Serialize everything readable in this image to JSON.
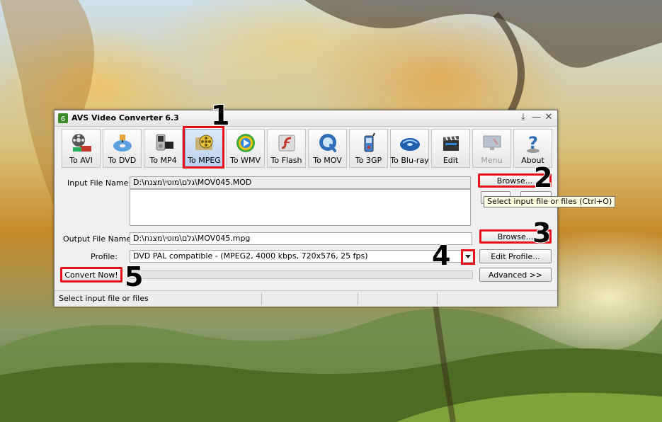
{
  "window": {
    "title": "AVS Video Converter 6.3"
  },
  "titlebar_controls": {
    "pin": "⤓",
    "minimize": "—",
    "close": "✕"
  },
  "toolbar": [
    {
      "label": "To AVI",
      "icon": "film-avi-icon"
    },
    {
      "label": "To DVD",
      "icon": "dvd-disc-icon"
    },
    {
      "label": "To MP4",
      "icon": "mp4-player-icon"
    },
    {
      "label": "To MPEG",
      "icon": "mpeg-reel-icon",
      "active": true
    },
    {
      "label": "To WMV",
      "icon": "wmv-play-icon"
    },
    {
      "label": "To Flash",
      "icon": "flash-icon"
    },
    {
      "label": "To MOV",
      "icon": "quicktime-icon"
    },
    {
      "label": "To 3GP",
      "icon": "mobile-phone-icon"
    },
    {
      "label": "To Blu-ray",
      "icon": "bluray-icon"
    },
    {
      "label": "Edit",
      "icon": "clapperboard-icon"
    },
    {
      "label": "Menu",
      "icon": "menu-screen-icon",
      "disabled": true
    },
    {
      "label": "About",
      "icon": "help-icon"
    }
  ],
  "input": {
    "label": "Input File Name:",
    "value": "D:\\גלם\\מוטי\\מצנח\\MOV045.MOD",
    "browse_label": "Browse...",
    "tooltip": "Select input file or files (Ctrl+O)"
  },
  "output": {
    "label": "Output File Name:",
    "value": "D:\\גלם\\מוטי\\מצנח\\MOV045.mpg",
    "browse_label": "Browse..."
  },
  "profile": {
    "label": "Profile:",
    "value": "DVD PAL compatible - (MPEG2, 4000 kbps, 720x576, 25 fps)",
    "edit_label": "Edit Profile..."
  },
  "actions": {
    "convert_label": "Convert Now!",
    "advanced_label": "Advanced >>"
  },
  "status": {
    "text": "Select input file or files"
  },
  "annotations": {
    "n1": "1",
    "n2": "2",
    "n3": "3",
    "n4": "4",
    "n5": "5"
  },
  "colors": {
    "highlight": "#e8101a",
    "active_tool": "#b8d1ef",
    "tooltip_bg": "#ffffe1"
  }
}
